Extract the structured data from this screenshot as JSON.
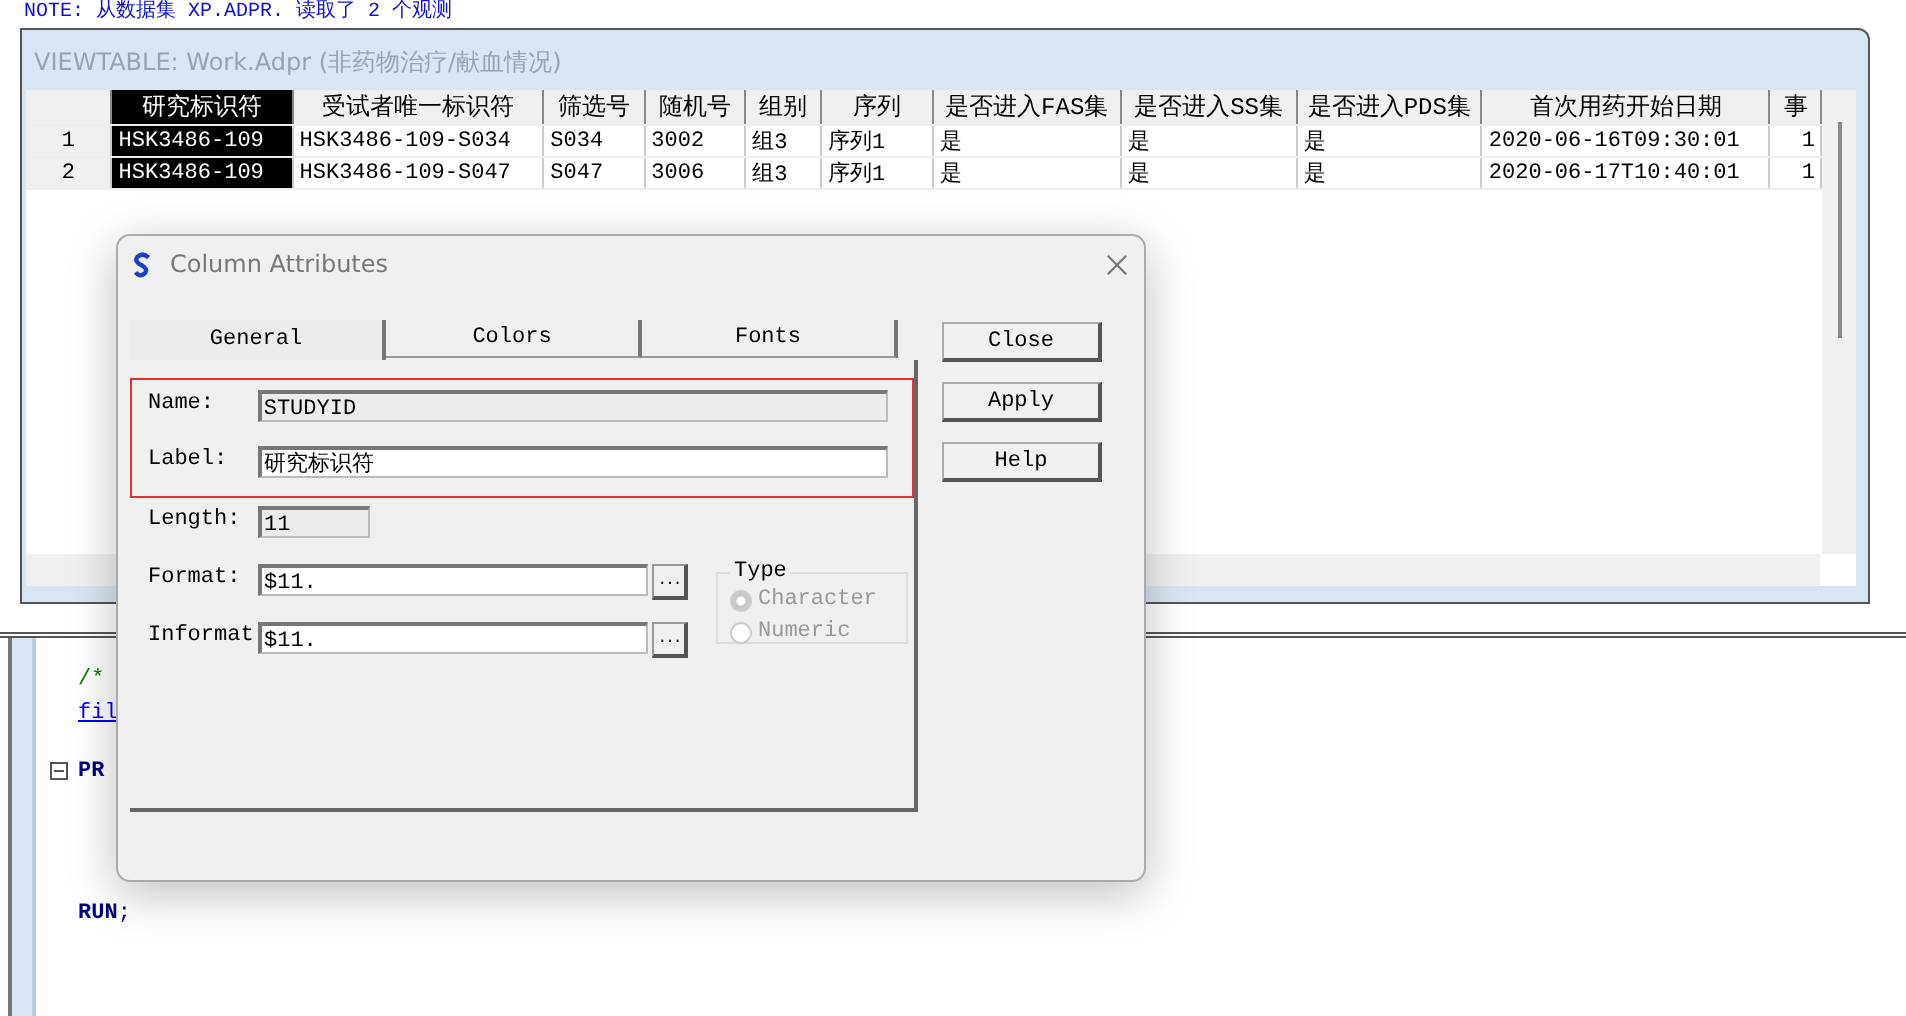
{
  "log_lines": [
    "NOTE: 从数据集 XP.ADPR. 读取了 2 个观测"
  ],
  "viewtable": {
    "title": "VIEWTABLE: Work.Adpr (非药物治疗/献血情况)",
    "columns": [
      {
        "label": "研究标识符",
        "selected": true
      },
      {
        "label": "受试者唯一标识符",
        "selected": false
      },
      {
        "label": "筛选号",
        "selected": false
      },
      {
        "label": "随机号",
        "selected": false
      },
      {
        "label": "组别",
        "selected": false
      },
      {
        "label": "序列",
        "selected": false
      },
      {
        "label": "是否进入FAS集",
        "selected": false
      },
      {
        "label": "是否进入SS集",
        "selected": false
      },
      {
        "label": "是否进入PDS集",
        "selected": false
      },
      {
        "label": "首次用药开始日期",
        "selected": false
      },
      {
        "label": "事",
        "selected": false
      }
    ],
    "rows": [
      {
        "number": "1",
        "cells": [
          "HSK3486-109",
          "HSK3486-109-S034",
          "S034",
          "3002",
          "组3",
          "序列1",
          "是",
          "是",
          "是",
          "2020-06-16T09:30:01",
          "1"
        ]
      },
      {
        "number": "2",
        "cells": [
          "HSK3486-109",
          "HSK3486-109-S047",
          "S047",
          "3006",
          "组3",
          "序列1",
          "是",
          "是",
          "是",
          "2020-06-17T10:40:01",
          "1"
        ]
      }
    ]
  },
  "editor": {
    "lines": [
      {
        "kind": "comment",
        "text": "/*"
      },
      {
        "kind": "link",
        "text": "fil"
      },
      {
        "kind": "fold",
        "text": "**PR**"
      },
      {
        "kind": "blank"
      },
      {
        "kind": "blank"
      },
      {
        "kind": "code",
        "text": "**RUN**;"
      }
    ]
  },
  "dialog": {
    "title": "Column Attributes",
    "tabs": [
      {
        "label": "General",
        "selected": true
      },
      {
        "label": "Colors",
        "selected": false
      },
      {
        "label": "Fonts",
        "selected": false
      }
    ],
    "fields": [
      {
        "label": "Name:",
        "value": "STUDYID",
        "readonly": true
      },
      {
        "label": "Label:",
        "value": "研究标识符",
        "readonly": false
      },
      {
        "label": "Length:",
        "value": "11",
        "readonly": true
      },
      {
        "label": "Format:",
        "value": "$11.",
        "readonly": false,
        "browse": "..."
      },
      {
        "label": "Informat",
        "value": "$11.",
        "readonly": false,
        "browse": "..."
      }
    ],
    "type_group": {
      "title": "Type",
      "options": [
        {
          "label": "Character",
          "selected": true,
          "disabled": true
        },
        {
          "label": "Numeric",
          "selected": false,
          "disabled": true
        }
      ]
    },
    "buttons": [
      "Close",
      "Apply",
      "Help"
    ]
  }
}
